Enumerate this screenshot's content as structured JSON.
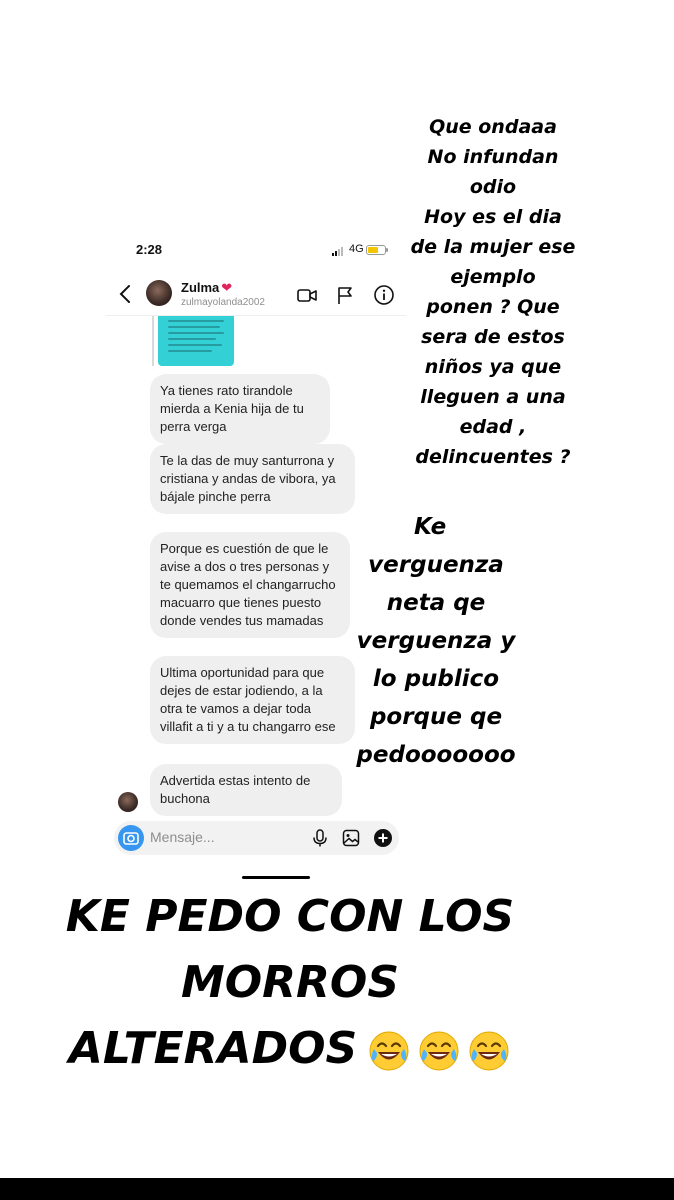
{
  "chat": {
    "status": {
      "time": "2:28",
      "network": "4G"
    },
    "header": {
      "name": "Zulma",
      "username": "zulmayolanda2002"
    },
    "messages": [
      "Ya tienes rato tirandole mierda a Kenia hija de tu perra verga",
      "Te la das de muy santurrona y cristiana y andas de vibora, ya bájale pinche perra",
      "Porque es cuestión de que le avise a dos o tres personas y te quemamos el changarrucho macuarro que tienes puesto donde vendes tus mamadas",
      "Ultima oportunidad para que dejes de estar jodiendo, a la otra te vamos a dejar toda villafit a ti y a tu changarro ese",
      "Advertida estas intento de buchona"
    ],
    "composer": {
      "placeholder": "Mensaje..."
    }
  },
  "captions": {
    "right": [
      "Que ondaaa",
      "No infundan",
      "odio",
      "Hoy es el dia",
      "de la mujer ese",
      "ejemplo",
      "ponen ? Que",
      "sera de estos",
      "niños ya que",
      "lleguen a una",
      "edad ,",
      "delincuentes ?"
    ],
    "middle": [
      "Ke",
      "verguenza",
      "neta qe",
      "verguenza y",
      "lo publico",
      "porque qe",
      "pedooooooo"
    ],
    "bottom": [
      "KE PEDO CON LOS",
      "MORROS",
      "ALTERADOS"
    ]
  },
  "colors": {
    "accent": "#3797f0",
    "shared_image": "#33d0d6",
    "heart": "#e0245e",
    "bubble": "#efefef"
  },
  "icons": [
    "back-icon",
    "heart-icon",
    "video-call-icon",
    "flag-icon",
    "info-icon",
    "camera-icon",
    "microphone-icon",
    "gallery-icon",
    "add-icon",
    "laughing-emoji-icon"
  ]
}
